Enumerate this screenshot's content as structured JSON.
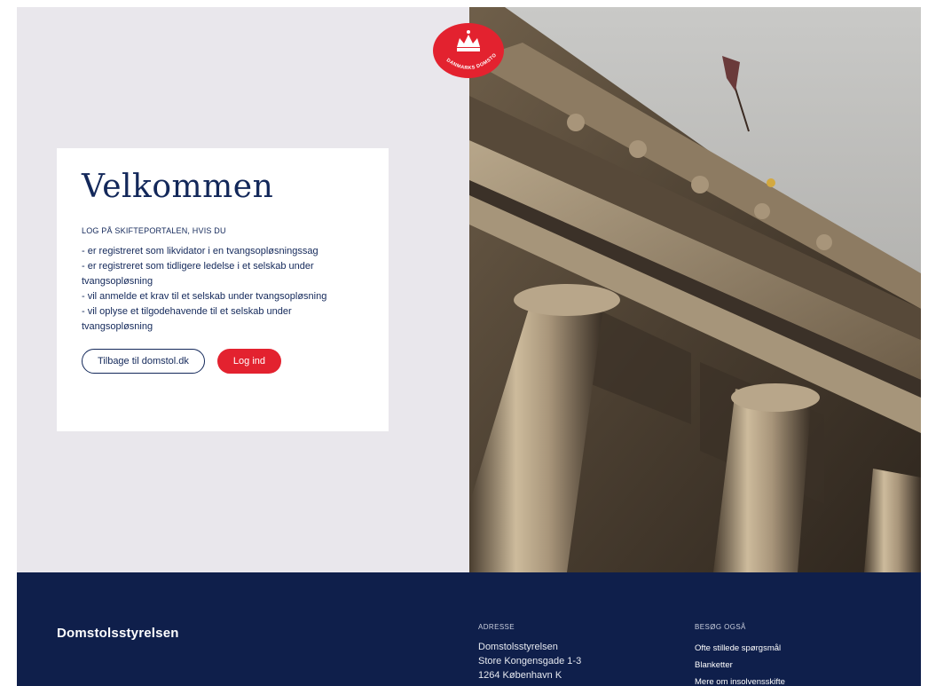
{
  "logo": {
    "text": "DANMARKS DOMSTOLE",
    "colors": {
      "badge": "#e3222f",
      "crown": "#ffffff"
    }
  },
  "welcome": {
    "title": "Velkommen",
    "intro": "LOG PÅ SKIFTEPORTALEN, HVIS DU",
    "items": [
      "- er registreret som likvidator i en tvangsopløsningssag",
      "- er registreret som tidligere ledelse i et selskab under tvangsopløsning",
      "- vil anmelde et krav til et selskab under tvangsopløsning",
      "- vil oplyse et tilgodehavende til et selskab under tvangsopløsning"
    ],
    "back_button": "Tilbage til domstol.dk",
    "login_button": "Log ind"
  },
  "footer": {
    "brand": "Domstolsstyrelsen",
    "address": {
      "heading": "ADRESSE",
      "lines": [
        "Domstolsstyrelsen",
        "Store Kongensgade 1-3",
        "1264 København K"
      ]
    },
    "visit": {
      "heading": "BESØG OGSÅ",
      "links": [
        "Ofte stillede spørgsmål",
        "Blanketter",
        "Mere om insolvensskifte"
      ]
    }
  },
  "colors": {
    "navy": "#13285a",
    "footer_bg": "#0f1f4b",
    "left_bg": "#e9e7ec",
    "accent_red": "#e3222f"
  },
  "icons": [
    "crown-icon"
  ]
}
